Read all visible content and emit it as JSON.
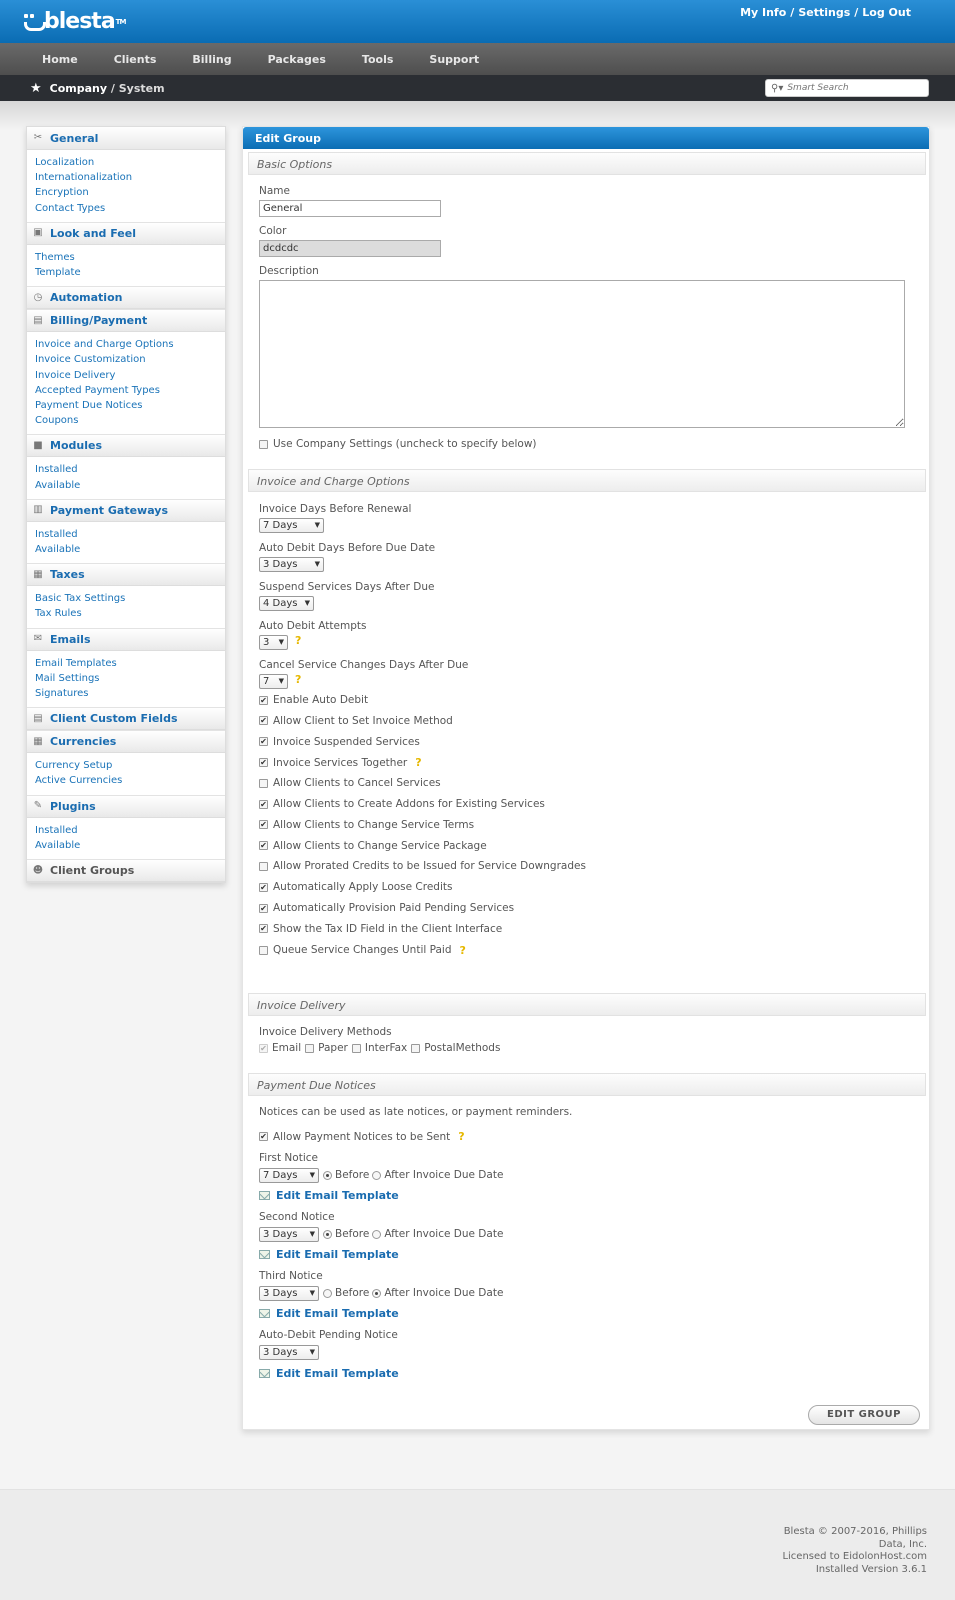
{
  "header": {
    "logo_text": "blesta",
    "logo_tm": "TM",
    "links": [
      "My Info",
      "Settings",
      "Log Out"
    ],
    "link_sep": "/"
  },
  "nav": {
    "items": [
      "Home",
      "Clients",
      "Billing",
      "Packages",
      "Tools",
      "Support"
    ]
  },
  "breadcrumb": {
    "part1": "Company",
    "sep": " / ",
    "part2": "System"
  },
  "search": {
    "placeholder": "Smart Search"
  },
  "sidebar": {
    "sections": [
      {
        "title": "General",
        "icon": "tools-icon",
        "items": [
          "Localization",
          "Internationalization",
          "Encryption",
          "Contact Types"
        ]
      },
      {
        "title": "Look and Feel",
        "icon": "palette-icon",
        "items": [
          "Themes",
          "Template"
        ]
      },
      {
        "title": "Automation",
        "icon": "clock-icon",
        "items": []
      },
      {
        "title": "Billing/Payment",
        "icon": "document-icon",
        "items": [
          "Invoice and Charge Options",
          "Invoice Customization",
          "Invoice Delivery",
          "Accepted Payment Types",
          "Payment Due Notices",
          "Coupons"
        ]
      },
      {
        "title": "Modules",
        "icon": "blocks-icon",
        "items": [
          "Installed",
          "Available"
        ]
      },
      {
        "title": "Payment Gateways",
        "icon": "bank-icon",
        "items": [
          "Installed",
          "Available"
        ]
      },
      {
        "title": "Taxes",
        "icon": "ledger-icon",
        "items": [
          "Basic Tax Settings",
          "Tax Rules"
        ]
      },
      {
        "title": "Emails",
        "icon": "envelope-icon",
        "items": [
          "Email Templates",
          "Mail Settings",
          "Signatures"
        ]
      },
      {
        "title": "Client Custom Fields",
        "icon": "form-icon",
        "items": []
      },
      {
        "title": "Currencies",
        "icon": "currency-icon",
        "items": [
          "Currency Setup",
          "Active Currencies"
        ]
      },
      {
        "title": "Plugins",
        "icon": "plug-icon",
        "items": [
          "Installed",
          "Available"
        ]
      },
      {
        "title": "Client Groups",
        "icon": "users-icon",
        "items": []
      }
    ]
  },
  "main": {
    "title": "Edit Group",
    "basic": {
      "heading": "Basic Options",
      "name_label": "Name",
      "name_value": "General",
      "color_label": "Color",
      "color_value": "dcdcdc",
      "description_label": "Description",
      "description_value": "",
      "use_company": "Use Company Settings (uncheck to specify below)"
    },
    "invoice": {
      "heading": "Invoice and Charge Options",
      "days_before_renewal_label": "Invoice Days Before Renewal",
      "days_before_renewal": "7 Days",
      "autodebit_days_label": "Auto Debit Days Before Due Date",
      "autodebit_days": "3 Days",
      "suspend_label": "Suspend Services Days After Due",
      "suspend": "4 Days",
      "attempts_label": "Auto Debit Attempts",
      "attempts": "3",
      "cancel_label": "Cancel Service Changes Days After Due",
      "cancel": "7",
      "help": "?",
      "checks": [
        {
          "label": "Enable Auto Debit",
          "checked": true,
          "help": false
        },
        {
          "label": "Allow Client to Set Invoice Method",
          "checked": true,
          "help": false
        },
        {
          "label": "Invoice Suspended Services",
          "checked": true,
          "help": false
        },
        {
          "label": "Invoice Services Together",
          "checked": true,
          "help": true
        },
        {
          "label": "Allow Clients to Cancel Services",
          "checked": false,
          "help": false
        },
        {
          "label": "Allow Clients to Create Addons for Existing Services",
          "checked": true,
          "help": false
        },
        {
          "label": "Allow Clients to Change Service Terms",
          "checked": true,
          "help": false
        },
        {
          "label": "Allow Clients to Change Service Package",
          "checked": true,
          "help": false
        },
        {
          "label": "Allow Prorated Credits to be Issued for Service Downgrades",
          "checked": false,
          "help": false
        },
        {
          "label": "Automatically Apply Loose Credits",
          "checked": true,
          "help": false
        },
        {
          "label": "Automatically Provision Paid Pending Services",
          "checked": true,
          "help": false
        },
        {
          "label": "Show the Tax ID Field in the Client Interface",
          "checked": true,
          "help": false
        },
        {
          "label": "Queue Service Changes Until Paid",
          "checked": false,
          "help": true
        }
      ]
    },
    "delivery": {
      "heading": "Invoice Delivery",
      "methods_label": "Invoice Delivery Methods",
      "methods": [
        "Email",
        "Paper",
        "InterFax",
        "PostalMethods"
      ]
    },
    "notices": {
      "heading": "Payment Due Notices",
      "intro": "Notices can be used as late notices, or payment reminders.",
      "allow_label": "Allow Payment Notices to be Sent",
      "first_label": "First Notice",
      "first_value": "7 Days",
      "second_label": "Second Notice",
      "second_value": "3 Days",
      "third_label": "Third Notice",
      "third_value": "3 Days",
      "autodebit_label": "Auto-Debit Pending Notice",
      "autodebit_value": "3 Days",
      "before": "Before",
      "after": "After Invoice Due Date",
      "edit_template": "Edit Email Template"
    },
    "submit": "EDIT GROUP"
  },
  "footer": {
    "line1": "Blesta © 2007-2016, Phillips",
    "line2": "Data, Inc.",
    "line3": "Licensed to EidolonHost.com",
    "line4": "Installed Version 3.6.1"
  }
}
